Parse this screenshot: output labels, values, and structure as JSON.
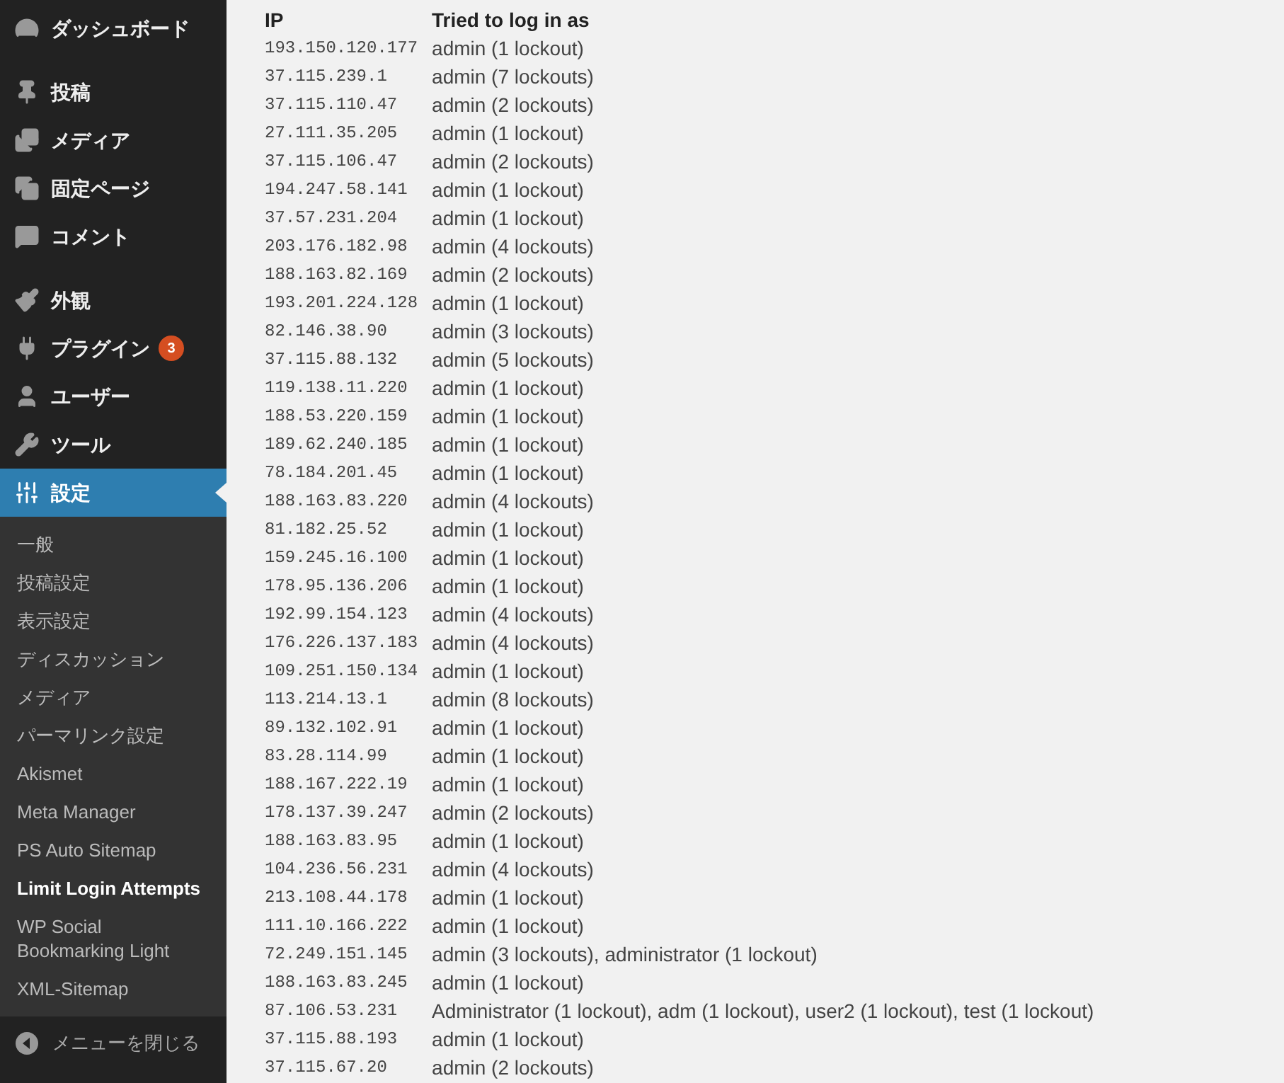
{
  "sidebar": {
    "menu_groups": [
      [
        {
          "label": "ダッシュボード",
          "selected": false
        }
      ],
      [
        {
          "label": "投稿",
          "selected": false
        },
        {
          "label": "メディア",
          "selected": false
        },
        {
          "label": "固定ページ",
          "selected": false
        },
        {
          "label": "コメント",
          "selected": false
        }
      ],
      [
        {
          "label": "外観",
          "selected": false
        },
        {
          "label": "プラグイン",
          "selected": false,
          "badge": "3"
        },
        {
          "label": "ユーザー",
          "selected": false
        },
        {
          "label": "ツール",
          "selected": false
        },
        {
          "label": "設定",
          "selected": true,
          "children": [
            {
              "label": "一般",
              "selected": false
            },
            {
              "label": "投稿設定",
              "selected": false
            },
            {
              "label": "表示設定",
              "selected": false
            },
            {
              "label": "ディスカッション",
              "selected": false
            },
            {
              "label": "メディア",
              "selected": false
            },
            {
              "label": "パーマリンク設定",
              "selected": false
            },
            {
              "label": "Akismet",
              "selected": false
            },
            {
              "label": "Meta Manager",
              "selected": false
            },
            {
              "label": "PS Auto Sitemap",
              "selected": false
            },
            {
              "label": "Limit Login Attempts",
              "selected": true
            },
            {
              "label": "WP Social Bookmarking Light",
              "selected": false
            },
            {
              "label": "XML-Sitemap",
              "selected": false
            }
          ]
        }
      ]
    ],
    "collapse_label": "メニューを閉じる"
  },
  "table": {
    "columns": [
      "IP",
      "Tried to log in as"
    ],
    "rows": [
      [
        "193.150.120.177",
        "admin (1 lockout)"
      ],
      [
        "37.115.239.1",
        "admin (7 lockouts)"
      ],
      [
        "37.115.110.47",
        "admin (2 lockouts)"
      ],
      [
        "27.111.35.205",
        "admin (1 lockout)"
      ],
      [
        "37.115.106.47",
        "admin (2 lockouts)"
      ],
      [
        "194.247.58.141",
        "admin (1 lockout)"
      ],
      [
        "37.57.231.204",
        "admin (1 lockout)"
      ],
      [
        "203.176.182.98",
        "admin (4 lockouts)"
      ],
      [
        "188.163.82.169",
        "admin (2 lockouts)"
      ],
      [
        "193.201.224.128",
        "admin (1 lockout)"
      ],
      [
        "82.146.38.90",
        "admin (3 lockouts)"
      ],
      [
        "37.115.88.132",
        "admin (5 lockouts)"
      ],
      [
        "119.138.11.220",
        "admin (1 lockout)"
      ],
      [
        "188.53.220.159",
        "admin (1 lockout)"
      ],
      [
        "189.62.240.185",
        "admin (1 lockout)"
      ],
      [
        "78.184.201.45",
        "admin (1 lockout)"
      ],
      [
        "188.163.83.220",
        "admin (4 lockouts)"
      ],
      [
        "81.182.25.52",
        "admin (1 lockout)"
      ],
      [
        "159.245.16.100",
        "admin (1 lockout)"
      ],
      [
        "178.95.136.206",
        "admin (1 lockout)"
      ],
      [
        "192.99.154.123",
        "admin (4 lockouts)"
      ],
      [
        "176.226.137.183",
        "admin (4 lockouts)"
      ],
      [
        "109.251.150.134",
        "admin (1 lockout)"
      ],
      [
        "113.214.13.1",
        "admin (8 lockouts)"
      ],
      [
        "89.132.102.91",
        "admin (1 lockout)"
      ],
      [
        "83.28.114.99",
        "admin (1 lockout)"
      ],
      [
        "188.167.222.19",
        "admin (1 lockout)"
      ],
      [
        "178.137.39.247",
        "admin (2 lockouts)"
      ],
      [
        "188.163.83.95",
        "admin (1 lockout)"
      ],
      [
        "104.236.56.231",
        "admin (4 lockouts)"
      ],
      [
        "213.108.44.178",
        "admin (1 lockout)"
      ],
      [
        "111.10.166.222",
        "admin (1 lockout)"
      ],
      [
        "72.249.151.145",
        "admin (3 lockouts), administrator (1 lockout)"
      ],
      [
        "188.163.83.245",
        "admin (1 lockout)"
      ],
      [
        "87.106.53.231",
        "Administrator (1 lockout), adm (1 lockout), user2 (1 lockout), test (1 lockout)"
      ],
      [
        "37.115.88.193",
        "admin (1 lockout)"
      ],
      [
        "37.115.67.20",
        "admin (2 lockouts)"
      ]
    ]
  }
}
